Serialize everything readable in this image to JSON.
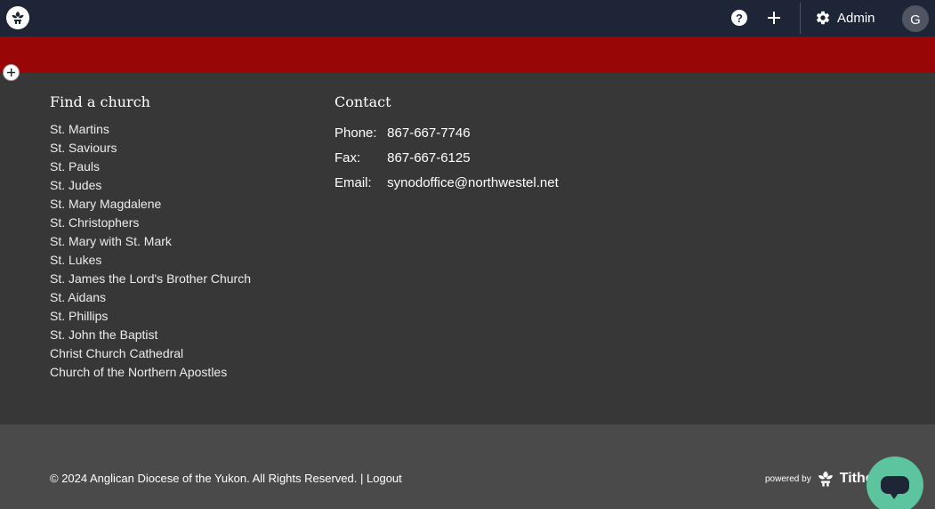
{
  "topbar": {
    "logo_icon": "tithely-leaf-logo-icon",
    "help_label": "?",
    "add_icon": "plus-icon",
    "admin_label": "Admin",
    "avatar_initial": "G"
  },
  "section_add_icon": "plus-icon",
  "footer": {
    "find_church": {
      "title": "Find a church",
      "items": [
        "St. Martins",
        "St. Saviours",
        "St. Pauls",
        "St. Judes",
        "St. Mary Magdalene",
        "St. Christophers",
        "St. Mary with St. Mark",
        "St. Lukes",
        "St. James the Lord's Brother Church",
        "St. Aidans",
        "St. Phillips",
        "St. John the Baptist",
        "Christ Church Cathedral",
        "Church of the Northern Apostles"
      ]
    },
    "contact": {
      "title": "Contact",
      "phone_label": "Phone:",
      "phone": "867-667-7746",
      "fax_label": "Fax:",
      "fax": "867-667-6125",
      "email_label": "Email:",
      "email": "synodoffice@northwestel.net"
    }
  },
  "bottom": {
    "copyright": "© 2024 Anglican Diocese of the Yukon. All Rights Reserved. |",
    "logout": "Logout",
    "powered_by": "powered by",
    "brand": "Tithe"
  },
  "colors": {
    "topbar": "#1e2536",
    "red_band": "#990606",
    "footer": "#373737",
    "bottom_bar": "#4a4a4a",
    "chat": "#5cc5a0"
  }
}
